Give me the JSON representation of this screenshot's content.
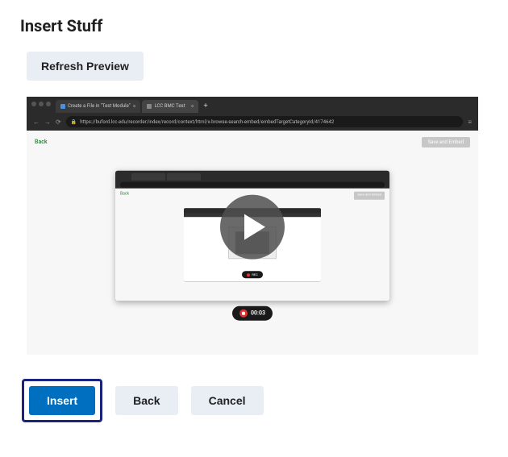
{
  "dialog": {
    "title": "Insert Stuff",
    "refresh_label": "Refresh Preview",
    "insert_label": "Insert",
    "back_label": "Back",
    "cancel_label": "Cancel"
  },
  "preview": {
    "outer_browser": {
      "tabs": [
        {
          "label": "Create a File in \"Test Module\"",
          "active": false,
          "favicon_color": "#4a90e2"
        },
        {
          "label": "LCC BMC Test",
          "active": true,
          "favicon_color": "#888"
        }
      ],
      "url_prefix_secure": true,
      "url": "https://buford.lcc.edu/recorder/index/record/context/html/x-browse-search-embed/embedTargetCategoryId/4174642"
    },
    "outer_page": {
      "back_link": "Back",
      "save_embed": "Save and Embed"
    },
    "inner_page": {
      "back_link": "Back",
      "save_embed": "Save and Embed",
      "deep_rec_label": "REC"
    },
    "timer": "00:03",
    "play_button_name": "play-video"
  },
  "colors": {
    "primary": "#006fbf",
    "focus_ring": "#1a237e",
    "secondary_bg": "#e9eef5",
    "record_red": "#e03131",
    "link_green": "#2b8a3e"
  }
}
